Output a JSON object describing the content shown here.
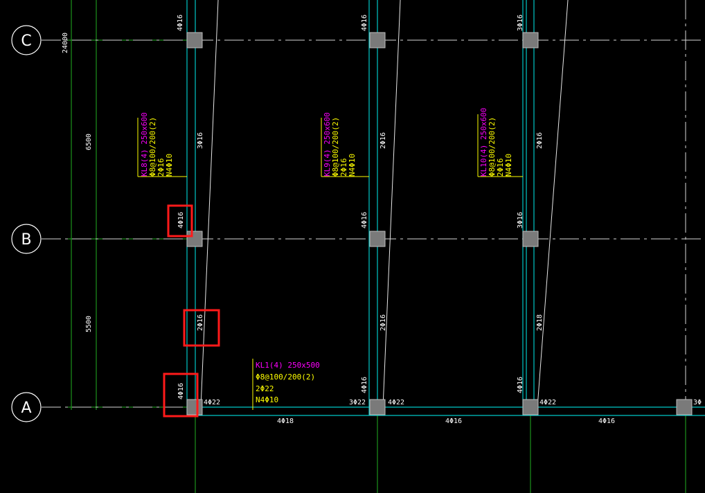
{
  "axes": [
    "C",
    "B",
    "A"
  ],
  "dimensions": {
    "total": "24000",
    "upper": "6500",
    "lower": "5500"
  },
  "vertical_beams": [
    {
      "labels": [
        "KL8(4) 250x600",
        "Φ8@100/200(2)",
        "2Φ16",
        "N4Φ10"
      ],
      "top_at_C": "4Φ16",
      "mid_upper": "3Φ16",
      "at_B": "4Φ16",
      "mid_lower": "2Φ16",
      "at_A": "4Φ16"
    },
    {
      "labels": [
        "KL9(4) 250x600",
        "Φ8@100/200(2)",
        "2Φ16",
        "N4Φ10"
      ],
      "top_at_C": "4Φ16",
      "mid_upper": "2Φ16",
      "at_B": "4Φ16",
      "mid_lower": "2Φ16",
      "at_A": "4Φ16"
    },
    {
      "labels": [
        "KL10(4) 250x600",
        "Φ8@100/200(2)",
        "2Φ16",
        "N4Φ10"
      ],
      "top_at_C": "3Φ16",
      "mid_upper": "2Φ16",
      "at_B": "3Φ16",
      "mid_lower": "2Φ18",
      "at_A": "4Φ16"
    }
  ],
  "beam_a": {
    "labels": [
      "KL1(4) 250x500",
      "Φ8@100/200(2)",
      "2Φ22",
      "N4Φ10"
    ],
    "support_texts": [
      "4Φ22",
      "3Φ22",
      "4Φ22",
      "4Φ22",
      "3Φ"
    ],
    "bottom_texts": [
      "4Φ18",
      "4Φ16",
      "4Φ16"
    ]
  },
  "colors": {
    "background": "#000000",
    "beam_cyan": "#00c8c8",
    "grid_green": "#22b022",
    "column_gray": "#808080",
    "highlight_red": "#ff1a1a",
    "label_magenta": "#ff00ff",
    "label_yellow": "#ffff00"
  }
}
